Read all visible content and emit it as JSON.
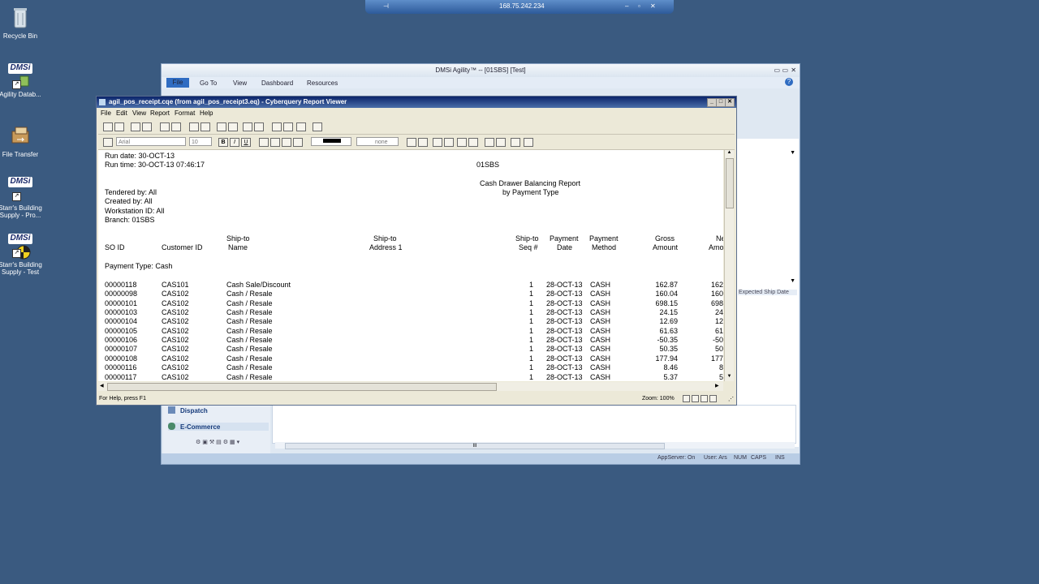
{
  "desktop": {
    "icons": [
      {
        "label": "Recycle Bin",
        "icon": "recycle-bin-icon"
      },
      {
        "label": "Agility Datab...",
        "icon": "dmsi-icon"
      },
      {
        "label": "File Transfer",
        "icon": "file-transfer-icon"
      },
      {
        "label": "Starr's Building Supply - Pro...",
        "icon": "dmsi-icon"
      },
      {
        "label": "Starr's Building Supply - Test",
        "icon": "dmsi-test-icon"
      }
    ],
    "logo_text": "DMSi"
  },
  "remote_bar": {
    "ip": "168.75.242.234"
  },
  "agility": {
    "title": "DMSi Agility™ -- [01SBS] [Test]",
    "menu": [
      "File",
      "Go To",
      "View",
      "Dashboard",
      "Resources"
    ],
    "side_labels": {
      "column_header": "Expected Ship Date"
    },
    "nav": [
      {
        "label": "Dispatch"
      },
      {
        "label": "E-Commerce"
      }
    ],
    "status": [
      "AppServer: On",
      "User: Ars",
      "NUM",
      "CAPS",
      "INS"
    ],
    "scroll_grip": "III"
  },
  "viewer": {
    "title": "agil_pos_receipt.cqe (from agil_pos_receipt3.eq) - Cyberquery Report Viewer",
    "menu": [
      "File",
      "Edit",
      "View",
      "Report",
      "Format",
      "Help"
    ],
    "font_combo": "Arial",
    "size_combo": "10",
    "fill_combo": "none",
    "status_left": "For Help, press F1",
    "zoom": "Zoom: 100%"
  },
  "report": {
    "run_date": "Run date: 30-OCT-13",
    "run_time": "Run time: 30-OCT-13 07:46:17",
    "branch_code": "01SBS",
    "title1": "Cash Drawer Balancing Report",
    "title2": "by Payment Type",
    "filters": [
      "Tendered by: All",
      "Created by: All",
      "Workstation ID: All",
      "Branch: 01SBS"
    ],
    "headers": {
      "so_id": "SO ID",
      "customer_id": "Customer ID",
      "shipto_name_1": "Ship-to",
      "shipto_name_2": "Name",
      "shipto_addr_1": "Ship-to",
      "shipto_addr_2": "Address 1",
      "shipto_seq_1": "Ship-to",
      "shipto_seq_2": "Seq #",
      "pay_date_1": "Payment",
      "pay_date_2": "Date",
      "pay_method_1": "Payment",
      "pay_method_2": "Method",
      "gross_1": "Gross",
      "gross_2": "Amount",
      "net_1": "Ne",
      "net_2": "Amo"
    },
    "payment_type": "Payment Type: Cash",
    "rows": [
      {
        "so": "00000118",
        "cust": "CAS101",
        "name": "Cash Sale/Discount",
        "seq": "1",
        "date": "28-OCT-13",
        "method": "CASH",
        "gross": "162.87",
        "net": "162"
      },
      {
        "so": "00000098",
        "cust": "CAS102",
        "name": "Cash / Resale",
        "seq": "1",
        "date": "28-OCT-13",
        "method": "CASH",
        "gross": "160.04",
        "net": "160"
      },
      {
        "so": "00000101",
        "cust": "CAS102",
        "name": "Cash / Resale",
        "seq": "1",
        "date": "28-OCT-13",
        "method": "CASH",
        "gross": "698.15",
        "net": "698"
      },
      {
        "so": "00000103",
        "cust": "CAS102",
        "name": "Cash / Resale",
        "seq": "1",
        "date": "28-OCT-13",
        "method": "CASH",
        "gross": "24.15",
        "net": "24"
      },
      {
        "so": "00000104",
        "cust": "CAS102",
        "name": "Cash / Resale",
        "seq": "1",
        "date": "28-OCT-13",
        "method": "CASH",
        "gross": "12.69",
        "net": "12"
      },
      {
        "so": "00000105",
        "cust": "CAS102",
        "name": "Cash / Resale",
        "seq": "1",
        "date": "28-OCT-13",
        "method": "CASH",
        "gross": "61.63",
        "net": "61"
      },
      {
        "so": "00000106",
        "cust": "CAS102",
        "name": "Cash / Resale",
        "seq": "1",
        "date": "28-OCT-13",
        "method": "CASH",
        "gross": "-50.35",
        "net": "-50"
      },
      {
        "so": "00000107",
        "cust": "CAS102",
        "name": "Cash / Resale",
        "seq": "1",
        "date": "28-OCT-13",
        "method": "CASH",
        "gross": "50.35",
        "net": "50"
      },
      {
        "so": "00000108",
        "cust": "CAS102",
        "name": "Cash / Resale",
        "seq": "1",
        "date": "28-OCT-13",
        "method": "CASH",
        "gross": "177.94",
        "net": "177"
      },
      {
        "so": "00000116",
        "cust": "CAS102",
        "name": "Cash / Resale",
        "seq": "1",
        "date": "28-OCT-13",
        "method": "CASH",
        "gross": "8.46",
        "net": "8"
      },
      {
        "so": "00000117",
        "cust": "CAS102",
        "name": "Cash / Resale",
        "seq": "1",
        "date": "28-OCT-13",
        "method": "CASH",
        "gross": "5.37",
        "net": "5"
      }
    ]
  },
  "colors": {
    "desktop": "#3a5a80",
    "title_active": "#0a246a",
    "agility_accent": "#2f6cc2"
  }
}
